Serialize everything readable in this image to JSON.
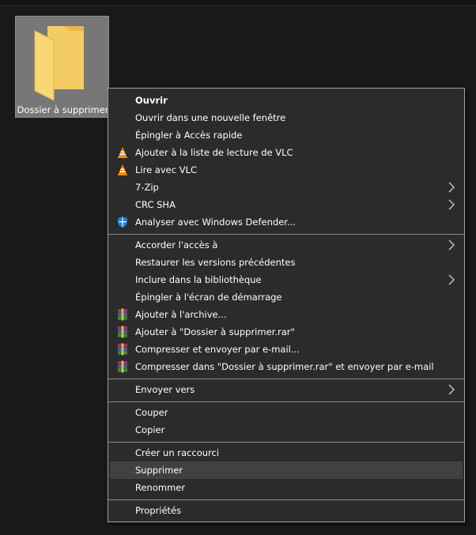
{
  "desktop": {
    "folder": {
      "name": "Dossier à supprimer",
      "icon": "folder-icon"
    }
  },
  "context_menu": {
    "items": [
      {
        "label": "Ouvrir",
        "bold": true,
        "icon": null,
        "submenu": false
      },
      {
        "label": "Ouvrir dans une nouvelle fenêtre",
        "icon": null,
        "submenu": false
      },
      {
        "label": "Épingler à Accès rapide",
        "icon": null,
        "submenu": false
      },
      {
        "label": "Ajouter à la liste de lecture de VLC",
        "icon": "vlc-icon",
        "submenu": false
      },
      {
        "label": "Lire avec VLC",
        "icon": "vlc-icon",
        "submenu": false
      },
      {
        "label": "7-Zip",
        "icon": null,
        "submenu": true
      },
      {
        "label": "CRC SHA",
        "icon": null,
        "submenu": true
      },
      {
        "label": "Analyser avec Windows Defender...",
        "icon": "windows-defender-icon",
        "submenu": false
      },
      {
        "label": "Accorder l'accès à",
        "icon": null,
        "submenu": true
      },
      {
        "label": "Restaurer les versions précédentes",
        "icon": null,
        "submenu": false
      },
      {
        "label": "Inclure dans la bibliothèque",
        "icon": null,
        "submenu": true
      },
      {
        "label": "Épingler à l'écran de démarrage",
        "icon": null,
        "submenu": false
      },
      {
        "label": "Ajouter à l'archive...",
        "icon": "winrar-icon",
        "submenu": false
      },
      {
        "label": "Ajouter à \"Dossier à supprimer.rar\"",
        "icon": "winrar-icon",
        "submenu": false
      },
      {
        "label": "Compresser et envoyer par e-mail...",
        "icon": "winrar-icon",
        "submenu": false
      },
      {
        "label": "Compresser dans \"Dossier à supprimer.rar\" et envoyer par e-mail",
        "icon": "winrar-icon",
        "submenu": false
      },
      {
        "label": "Envoyer vers",
        "icon": null,
        "submenu": true
      },
      {
        "label": "Couper",
        "icon": null,
        "submenu": false
      },
      {
        "label": "Copier",
        "icon": null,
        "submenu": false
      },
      {
        "label": "Créer un raccourci",
        "icon": null,
        "submenu": false
      },
      {
        "label": "Supprimer",
        "icon": null,
        "submenu": false,
        "highlighted": true
      },
      {
        "label": "Renommer",
        "icon": null,
        "submenu": false
      },
      {
        "label": "Propriétés",
        "icon": null,
        "submenu": false
      }
    ]
  },
  "colors": {
    "menu_bg": "#2b2b2b",
    "highlight_bg": "#414141",
    "folder_yellow": "#f8d775",
    "selection_bg": "#777777"
  }
}
